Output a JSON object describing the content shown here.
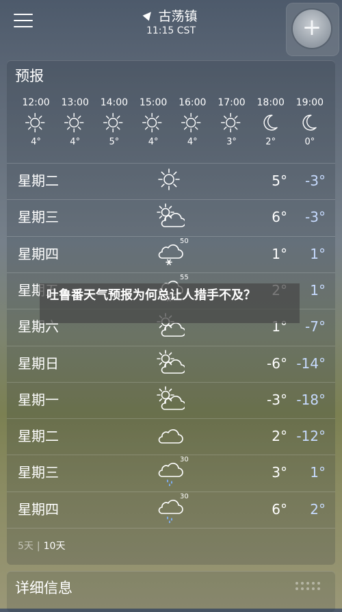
{
  "header": {
    "location": "古荡镇",
    "time": "11:15 CST",
    "menu_icon": "menu-icon",
    "location_icon": "location-arrow-icon",
    "add_icon": "plus-icon"
  },
  "forecast": {
    "title": "预报",
    "hourly": [
      {
        "time": "12:00",
        "icon": "sun-icon",
        "temp": "4°"
      },
      {
        "time": "13:00",
        "icon": "sun-icon",
        "temp": "4°"
      },
      {
        "time": "14:00",
        "icon": "sun-icon",
        "temp": "5°"
      },
      {
        "time": "15:00",
        "icon": "sun-icon",
        "temp": "4°"
      },
      {
        "time": "16:00",
        "icon": "sun-icon",
        "temp": "4°"
      },
      {
        "time": "17:00",
        "icon": "sun-icon",
        "temp": "3°"
      },
      {
        "time": "18:00",
        "icon": "moon-icon",
        "temp": "2°"
      },
      {
        "time": "19:00",
        "icon": "moon-icon",
        "temp": "0°"
      }
    ],
    "daily": [
      {
        "day": "星期二",
        "icon": "sun-icon",
        "pop": "",
        "high": "5°",
        "low": "-3°"
      },
      {
        "day": "星期三",
        "icon": "partly-cloudy-icon",
        "pop": "",
        "high": "6°",
        "low": "-3°"
      },
      {
        "day": "星期四",
        "icon": "cloud-snow-icon",
        "pop": "50",
        "high": "1°",
        "low": "1°"
      },
      {
        "day": "星期五",
        "icon": "cloud-snow-icon",
        "pop": "55",
        "high": "2°",
        "low": "1°"
      },
      {
        "day": "星期六",
        "icon": "partly-cloudy-icon",
        "pop": "",
        "high": "1°",
        "low": "-7°"
      },
      {
        "day": "星期日",
        "icon": "partly-cloudy-icon",
        "pop": "",
        "high": "-6°",
        "low": "-14°"
      },
      {
        "day": "星期一",
        "icon": "partly-cloudy-icon",
        "pop": "",
        "high": "-3°",
        "low": "-18°"
      },
      {
        "day": "星期二",
        "icon": "cloudy-icon",
        "pop": "",
        "high": "2°",
        "low": "-12°"
      },
      {
        "day": "星期三",
        "icon": "cloud-rain-icon",
        "pop": "30",
        "high": "3°",
        "low": "1°"
      },
      {
        "day": "星期四",
        "icon": "cloud-rain-icon",
        "pop": "30",
        "high": "6°",
        "low": "2°"
      }
    ],
    "range_5": "5天",
    "range_10": "10天"
  },
  "details": {
    "title": "详细信息"
  },
  "overlay": {
    "text": "吐鲁番天气预报为何总让人措手不及？"
  }
}
